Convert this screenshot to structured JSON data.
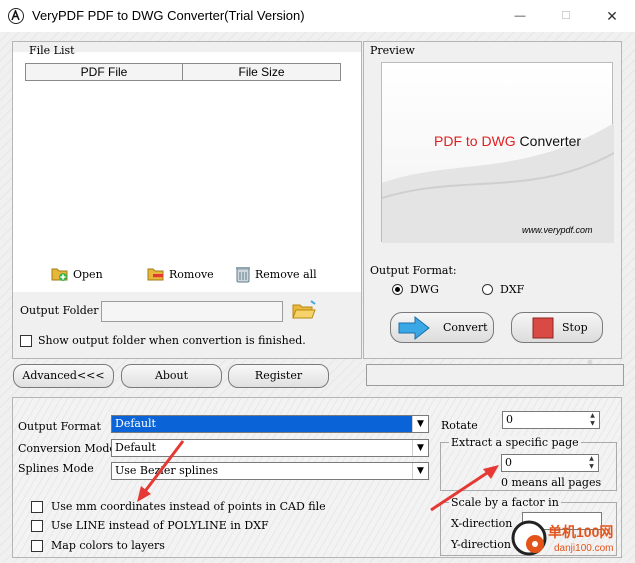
{
  "window": {
    "title": "VeryPDF PDF to DWG Converter(Trial Version)",
    "minimize_glyph": "—",
    "maximize_glyph": "☐",
    "close_glyph": "✕"
  },
  "file_list": {
    "title": "File List",
    "columns": [
      "PDF File",
      "File Size"
    ],
    "actions": {
      "open": "Open",
      "remove": "Romove",
      "remove_all": "Remove all"
    },
    "output_folder_label": "Output Folder",
    "output_folder_value": "",
    "show_folder_label": "Show output folder when convertion is finished."
  },
  "preview": {
    "title": "Preview",
    "image_text_red": "PDF to DWG",
    "image_text_black": " Converter",
    "image_url": "www.verypdf.com",
    "output_format_label": "Output Format:",
    "formats": [
      "DWG",
      "DXF"
    ],
    "selected_format": "DWG",
    "convert_label": "Convert",
    "stop_label": "Stop"
  },
  "buttons": {
    "advanced": "Advanced<<<",
    "about": "About",
    "register": "Register"
  },
  "options": {
    "output_format_label": "Output Format",
    "output_format_value": "Default",
    "conversion_mode_label": "Conversion Mode",
    "conversion_mode_value": "Default",
    "splines_mode_label": "Splines Mode",
    "splines_mode_value": "Use Bezier splines",
    "checkbox_mm": "Use mm coordinates instead of points in CAD file",
    "checkbox_line": "Use LINE instead of POLYLINE in DXF",
    "checkbox_layers": "Map colors to layers",
    "rotate_label": "Rotate",
    "rotate_value": "0",
    "extract_group": "Extract a specific page",
    "extract_value": "0",
    "extract_hint": "0 means all pages",
    "scale_group": "Scale by a factor in",
    "x_direction": "X-direction",
    "y_direction": "Y-direction",
    "x_value": "",
    "y_value": ""
  },
  "watermark": {
    "line1": "单机100网",
    "line2": "danji100.com"
  },
  "colors": {
    "selection_blue": "#0a64d8",
    "annotation_red": "#e53935",
    "watermark_orange": "#e3541a",
    "convert_arrow": "#3aa7e6",
    "stop_square": "#d94a45"
  }
}
